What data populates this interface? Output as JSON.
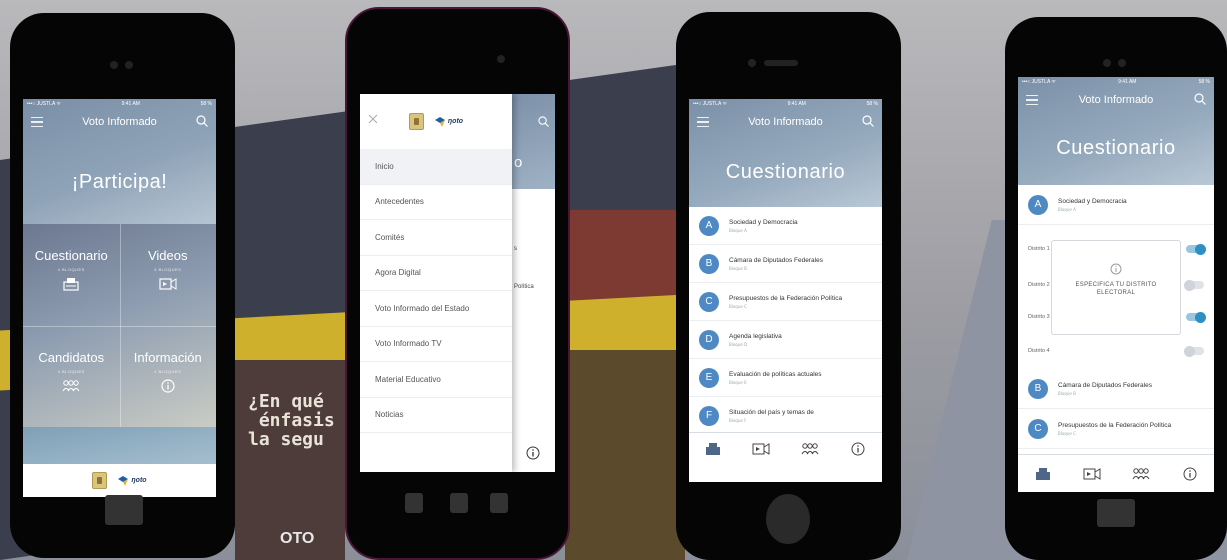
{
  "colors": {
    "accent": "#4e89c4",
    "toggle_on": "#2e8fc2",
    "hero": "#8fa3b8"
  },
  "status": {
    "carrier": "•••○ JUSTLA ᯤ",
    "time": "9:41 AM",
    "battery": "58 %"
  },
  "app": {
    "title": "Voto Informado",
    "logo_text": "ŋoto"
  },
  "home": {
    "headline": "¡Participa!",
    "tiles": [
      {
        "label": "Cuestionario",
        "sub": "4 BLOQUES",
        "icon": "ballot-box-icon"
      },
      {
        "label": "Videos",
        "sub": "4 BLOQUES",
        "icon": "video-icon"
      },
      {
        "label": "Candidatos",
        "sub": "4 BLOQUES",
        "icon": "people-icon"
      },
      {
        "label": "Información",
        "sub": "4 BLOQUES",
        "icon": "info-icon"
      }
    ]
  },
  "menu": {
    "items": [
      "Inicio",
      "Antecedentes",
      "Comités",
      "Agora Digital",
      "Voto Informado del Estado",
      "Voto Informado TV",
      "Material Educativo",
      "Noticias"
    ],
    "peek_texts": [
      "o",
      "s",
      "Política"
    ]
  },
  "questionnaire": {
    "title": "Cuestionario",
    "items": [
      {
        "letter": "A",
        "name": "Sociedad y Democracia",
        "sub": "Bloque A"
      },
      {
        "letter": "B",
        "name": "Cámara de Diputados Federales",
        "sub": "Bloque B"
      },
      {
        "letter": "C",
        "name": "Presupuestos de la Federación Política",
        "sub": "Bloque C"
      },
      {
        "letter": "D",
        "name": "Agenda legislativa",
        "sub": "Bloque D"
      },
      {
        "letter": "E",
        "name": "Evaluación de políticas actuales",
        "sub": "Bloque E"
      },
      {
        "letter": "F",
        "name": "Situación del país y temas de",
        "sub": "Bloque F"
      }
    ]
  },
  "district": {
    "title": "Cuestionario",
    "first": {
      "letter": "A",
      "name": "Sociedad y Democracia",
      "sub": "Bloque A"
    },
    "rows": [
      {
        "label": "Distrito 1",
        "on": true
      },
      {
        "label": "Distrito 2",
        "on": false
      },
      {
        "label": "Distrito 3",
        "on": true
      },
      {
        "label": "Distrito 4",
        "on": false
      }
    ],
    "dialog_text": "ESPECIFICA TU DISTRITO ELECTORAL",
    "after": [
      {
        "letter": "B",
        "name": "Cámara de Diputados Federales",
        "sub": "Bloque B"
      },
      {
        "letter": "C",
        "name": "Presupuestos de la Federación Política",
        "sub": "Bloque C"
      }
    ]
  },
  "background": {
    "slogan": "¿En qué\n énfasis\nla segu",
    "poster": "OTO"
  }
}
